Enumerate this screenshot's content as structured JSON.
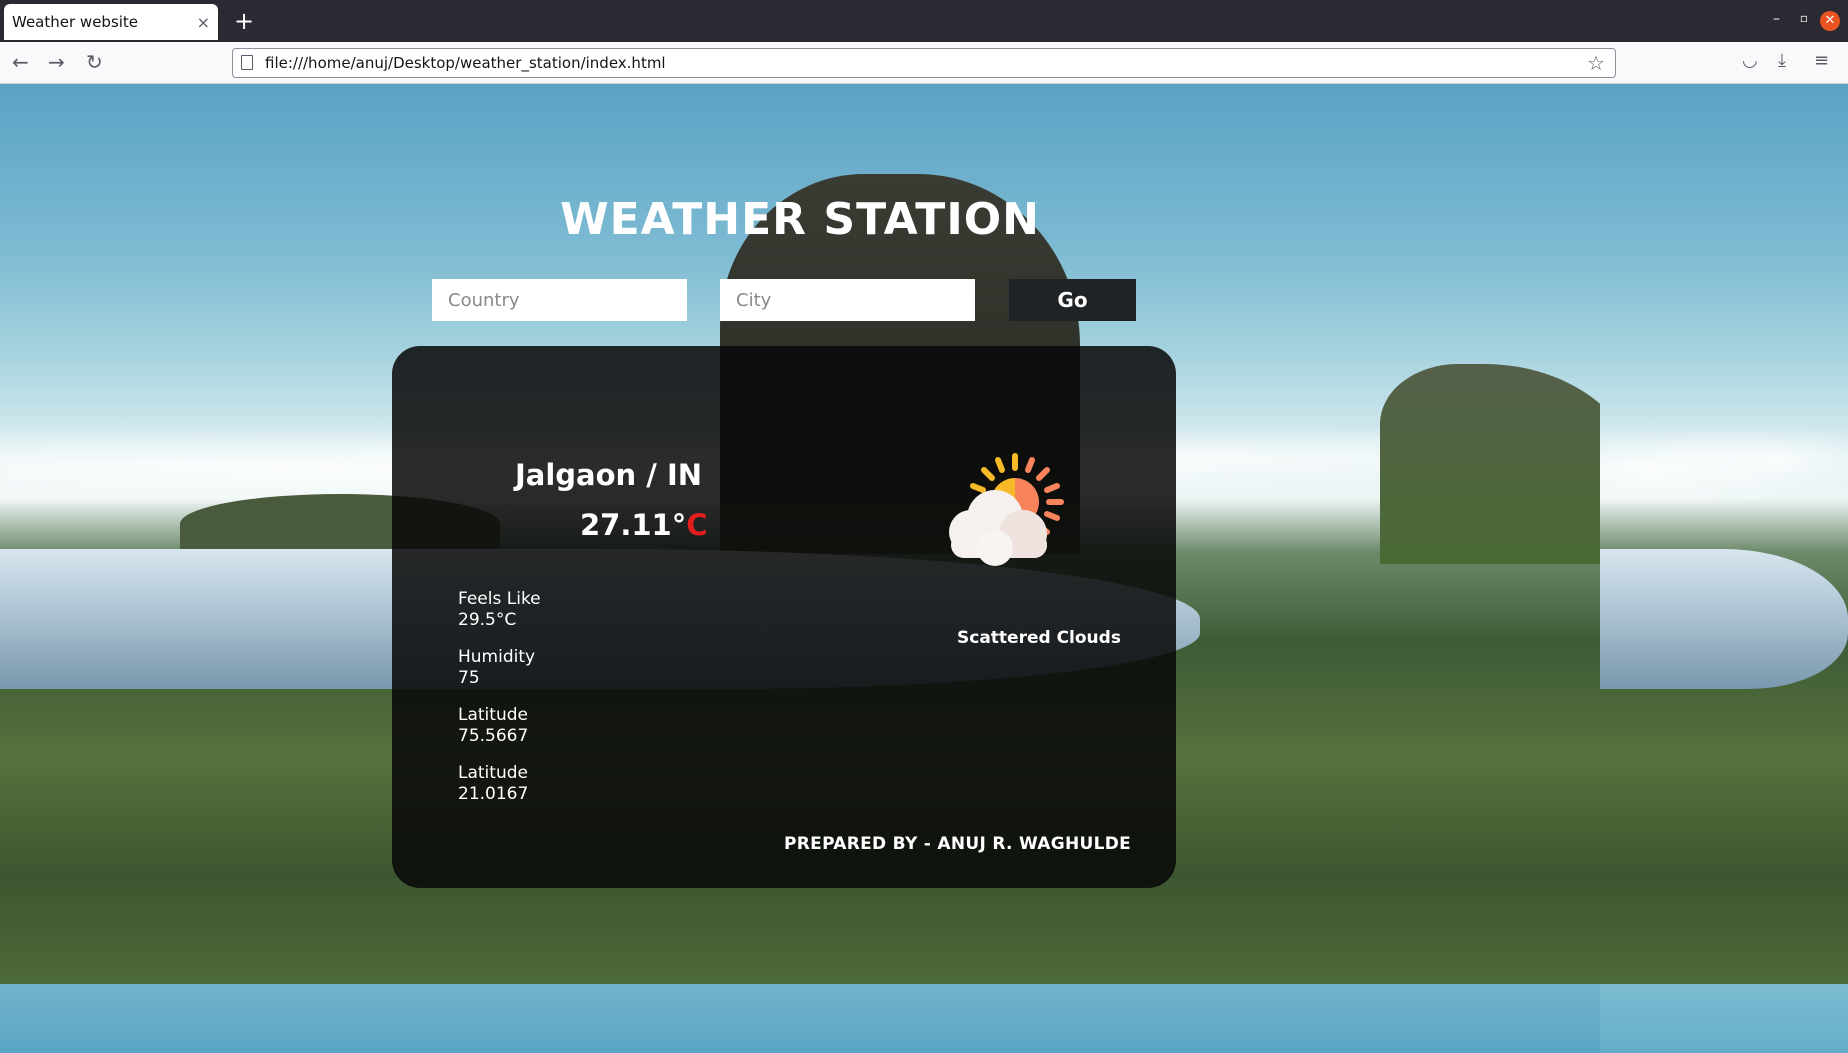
{
  "browser": {
    "tab_title": "Weather website",
    "tab_close": "×",
    "new_tab": "+",
    "url": "file:///home/anuj/Desktop/weather_station/index.html"
  },
  "page": {
    "title": "WEATHER STATION",
    "country_placeholder": "Country",
    "city_placeholder": "City",
    "go_label": "Go"
  },
  "weather": {
    "location": "Jalgaon / IN",
    "temperature": "27.11°",
    "temperature_unit": "C",
    "details": [
      {
        "label": "Feels Like",
        "value": "29.5°C"
      },
      {
        "label": "Humidity",
        "value": "75"
      },
      {
        "label": "Latitude",
        "value": "75.5667"
      },
      {
        "label": "Latitude",
        "value": "21.0167"
      }
    ],
    "condition": "Scattered Clouds",
    "icon": "sun-behind-cloud-icon"
  },
  "footer": {
    "credit": "PREPARED BY - ANUJ R. WAGHULDE"
  },
  "colors": {
    "accent_red": "#e11d1d",
    "button_dark": "#1f2326",
    "sun_yellow": "#f7b928",
    "sun_orange": "#f9845b"
  }
}
